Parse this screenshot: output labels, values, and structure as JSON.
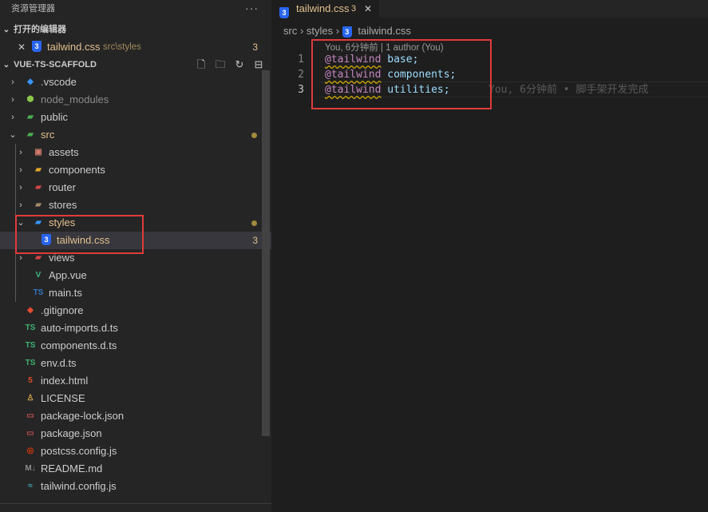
{
  "sidebar": {
    "title": "资源管理器",
    "more": "···",
    "open_editors": {
      "header": "打开的编辑器",
      "items": [
        {
          "close": "✕",
          "name": "tailwind.css",
          "path": "src\\styles",
          "badge": "3"
        }
      ]
    },
    "project": {
      "header": "VUE-TS-SCAFFOLD",
      "actions": [
        "new-file-icon",
        "new-folder-icon",
        "refresh-icon",
        "collapse-all-icon"
      ],
      "tree": [
        {
          "label": ".vscode",
          "icon": "vscode-folder-icon",
          "glyph": "◆",
          "color": "#3794ff",
          "depth": 0,
          "chev": "›"
        },
        {
          "label": "node_modules",
          "icon": "node-folder-icon",
          "glyph": "⬢",
          "color": "#8cc84b",
          "depth": 0,
          "chev": "›",
          "dim": true
        },
        {
          "label": "public",
          "icon": "public-folder-icon",
          "glyph": "▰",
          "color": "#4caf50",
          "depth": 0,
          "chev": "›"
        },
        {
          "label": "src",
          "icon": "src-folder-icon",
          "glyph": "▰",
          "color": "#4caf50",
          "depth": 0,
          "chev": "⌄",
          "modified": true,
          "dot": true
        },
        {
          "label": "assets",
          "icon": "assets-folder-icon",
          "glyph": "▣",
          "color": "#d17a6b",
          "depth": 1,
          "chev": "›"
        },
        {
          "label": "components",
          "icon": "components-folder-icon",
          "glyph": "▰",
          "color": "#e5a82a",
          "depth": 1,
          "chev": "›"
        },
        {
          "label": "router",
          "icon": "router-folder-icon",
          "glyph": "▰",
          "color": "#d04545",
          "depth": 1,
          "chev": "›"
        },
        {
          "label": "stores",
          "icon": "stores-folder-icon",
          "glyph": "▰",
          "color": "#a38b69",
          "depth": 1,
          "chev": "›"
        },
        {
          "label": "styles",
          "icon": "styles-folder-icon",
          "glyph": "▰",
          "color": "#3794ff",
          "depth": 1,
          "chev": "⌄",
          "modified": true,
          "dot": true
        },
        {
          "label": "tailwind.css",
          "icon": "css-file-icon",
          "glyph": "3",
          "color": "#2965f1",
          "depth": 2,
          "chev": "",
          "modified": true,
          "badge": "3",
          "selected": true
        },
        {
          "label": "views",
          "icon": "views-folder-icon",
          "glyph": "▰",
          "color": "#d04545",
          "depth": 1,
          "chev": "›"
        },
        {
          "label": "App.vue",
          "icon": "vue-file-icon",
          "glyph": "V",
          "color": "#41b883",
          "depth": 1,
          "chev": ""
        },
        {
          "label": "main.ts",
          "icon": "ts-file-icon",
          "glyph": "TS",
          "color": "#3178c6",
          "depth": 1,
          "chev": ""
        },
        {
          "label": ".gitignore",
          "icon": "git-file-icon",
          "glyph": "◆",
          "color": "#e44c30",
          "depth": 0,
          "chev": ""
        },
        {
          "label": "auto-imports.d.ts",
          "icon": "ts-def-file-icon",
          "glyph": "TS",
          "color": "#3eb370",
          "depth": 0,
          "chev": ""
        },
        {
          "label": "components.d.ts",
          "icon": "ts-def-file-icon",
          "glyph": "TS",
          "color": "#3eb370",
          "depth": 0,
          "chev": ""
        },
        {
          "label": "env.d.ts",
          "icon": "ts-def-file-icon",
          "glyph": "TS",
          "color": "#3eb370",
          "depth": 0,
          "chev": ""
        },
        {
          "label": "index.html",
          "icon": "html-file-icon",
          "glyph": "5",
          "color": "#e44d26",
          "depth": 0,
          "chev": ""
        },
        {
          "label": "LICENSE",
          "icon": "license-file-icon",
          "glyph": "♙",
          "color": "#cfa64a",
          "depth": 0,
          "chev": ""
        },
        {
          "label": "package-lock.json",
          "icon": "npm-file-icon",
          "glyph": "▭",
          "color": "#c44d4d",
          "depth": 0,
          "chev": ""
        },
        {
          "label": "package.json",
          "icon": "npm-file-icon",
          "glyph": "▭",
          "color": "#c44d4d",
          "depth": 0,
          "chev": ""
        },
        {
          "label": "postcss.config.js",
          "icon": "postcss-file-icon",
          "glyph": "◎",
          "color": "#dd3a0a",
          "depth": 0,
          "chev": ""
        },
        {
          "label": "README.md",
          "icon": "markdown-file-icon",
          "glyph": "M↓",
          "color": "#8a8a8a",
          "depth": 0,
          "chev": ""
        },
        {
          "label": "tailwind.config.js",
          "icon": "tailwind-file-icon",
          "glyph": "≈",
          "color": "#44a8b3",
          "depth": 0,
          "chev": ""
        }
      ]
    }
  },
  "editor": {
    "tab": {
      "name": "tailwind.css",
      "badge": "3",
      "close": "✕"
    },
    "breadcrumb": [
      "src",
      "styles",
      "tailwind.css"
    ],
    "codelens": "You, 6分钟前 | 1 author (You)",
    "lines": [
      {
        "num": "1",
        "directive": "@tailwind",
        "value": "base;"
      },
      {
        "num": "2",
        "directive": "@tailwind",
        "value": "components;"
      },
      {
        "num": "3",
        "directive": "@tailwind",
        "value": "utilities;"
      }
    ],
    "blame": "You, 6分钟前 • 脚手架开发完成"
  }
}
